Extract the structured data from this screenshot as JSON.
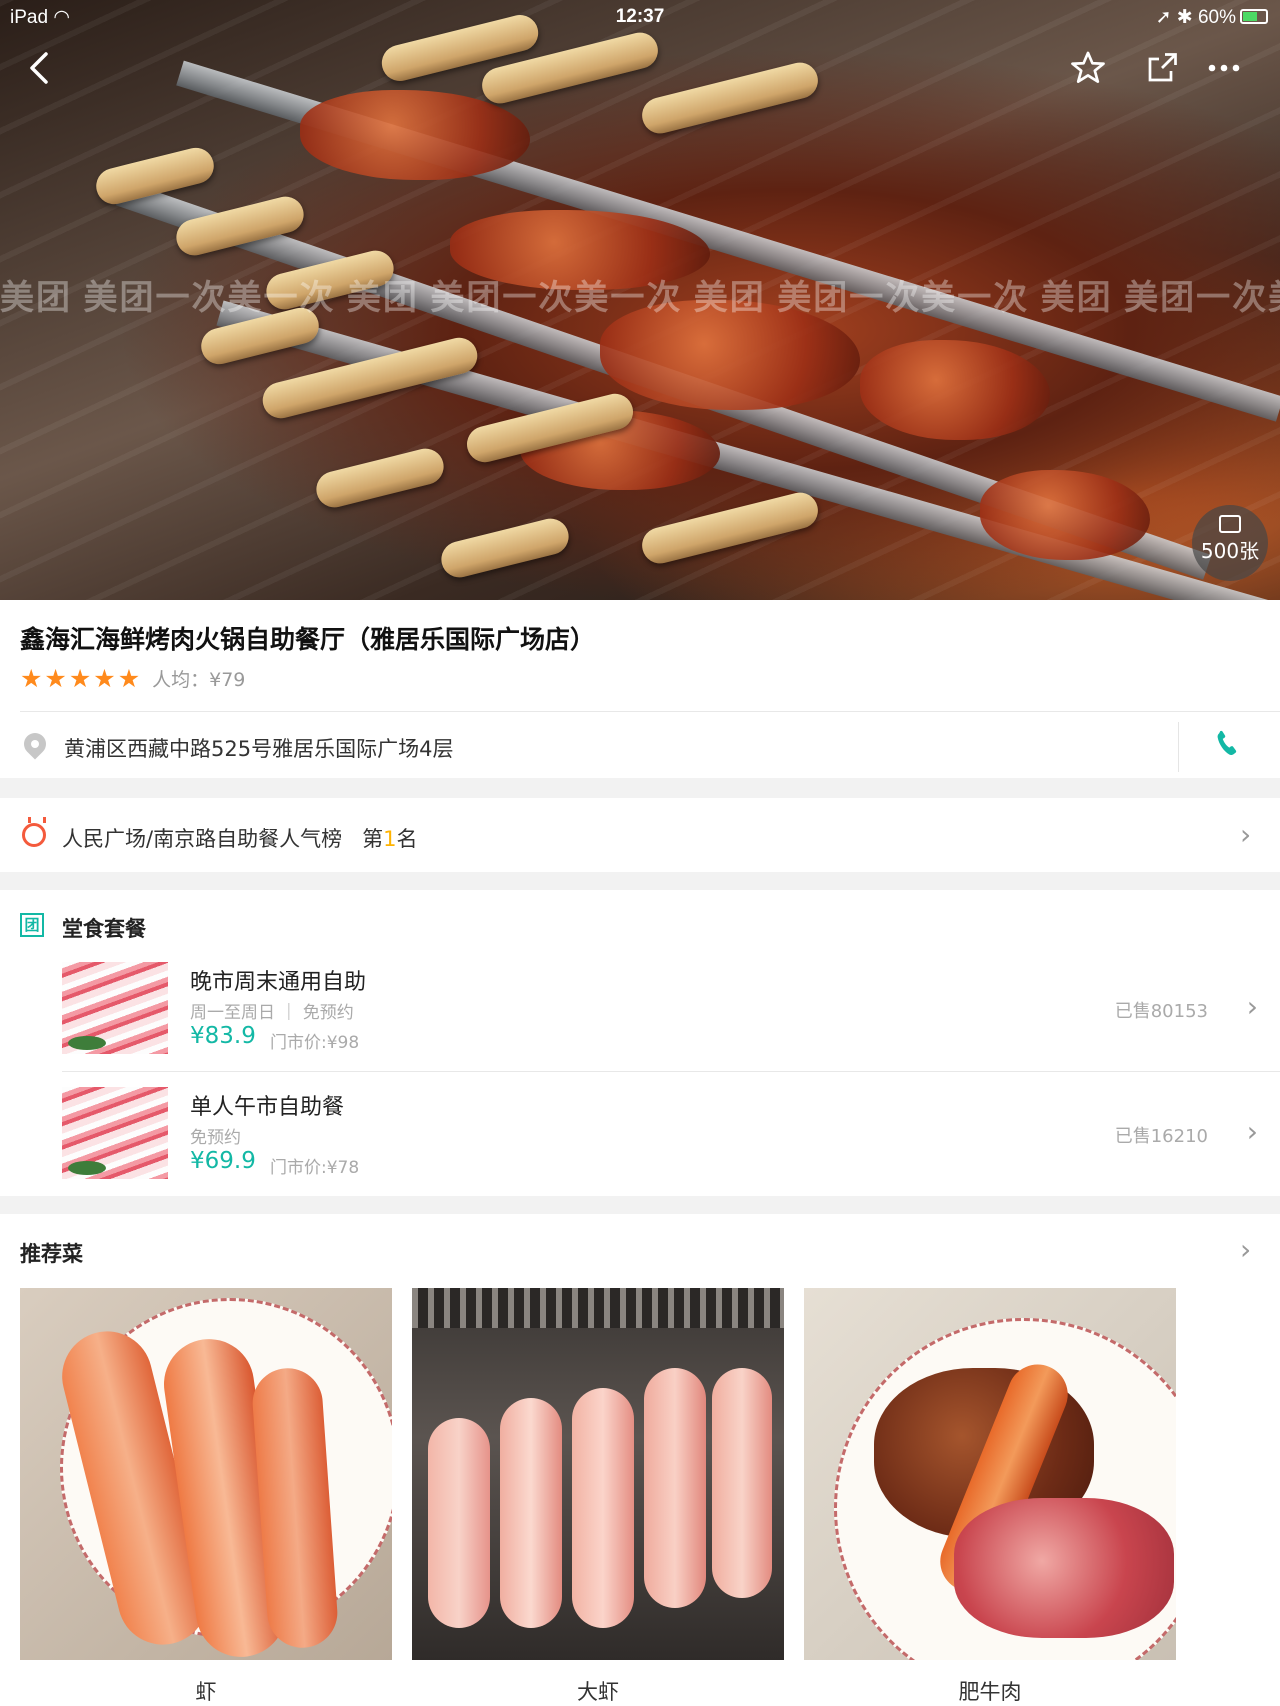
{
  "status_bar": {
    "device": "iPad",
    "time": "12:37",
    "battery": "60%",
    "battery_level": 0.6
  },
  "header": {
    "back_icon": "chevron-left-icon",
    "favorite_icon": "star-icon",
    "share_icon": "share-icon",
    "more_icon": "more-dots-icon",
    "photo_count": "500张",
    "watermark": "美团 美团一次美一次 美团 美团一次美一次 美团 美团一次美一次 美团 美团一次美一次"
  },
  "shop": {
    "name": "鑫海汇海鲜烤肉火锅自助餐厅（雅居乐国际广场店）",
    "stars": 5,
    "avg_price": "人均：¥79",
    "address": "黄浦区西藏中路525号雅居乐国际广场4层"
  },
  "ranking": {
    "label": "人民广场/南京路自助餐人气榜",
    "prefix": "第",
    "number": "1",
    "suffix": "名"
  },
  "deals": {
    "badge": "团",
    "title": "堂食套餐",
    "items": [
      {
        "name": "晚市周末通用自助",
        "sub": "周一至周日 ｜ 免预约",
        "price": "¥83.9",
        "market": "门市价:¥98",
        "sold": "已售80153"
      },
      {
        "name": "单人午市自助餐",
        "sub": "免预约",
        "price": "¥69.9",
        "market": "门市价:¥78",
        "sold": "已售16210"
      }
    ]
  },
  "recommended": {
    "title": "推荐菜",
    "dishes": [
      {
        "name": "虾"
      },
      {
        "name": "大虾"
      },
      {
        "name": "肥牛肉"
      }
    ]
  },
  "colors": {
    "accent": "#13b8a5",
    "star": "#ff8a1c",
    "rank_number": "#ffb300"
  }
}
